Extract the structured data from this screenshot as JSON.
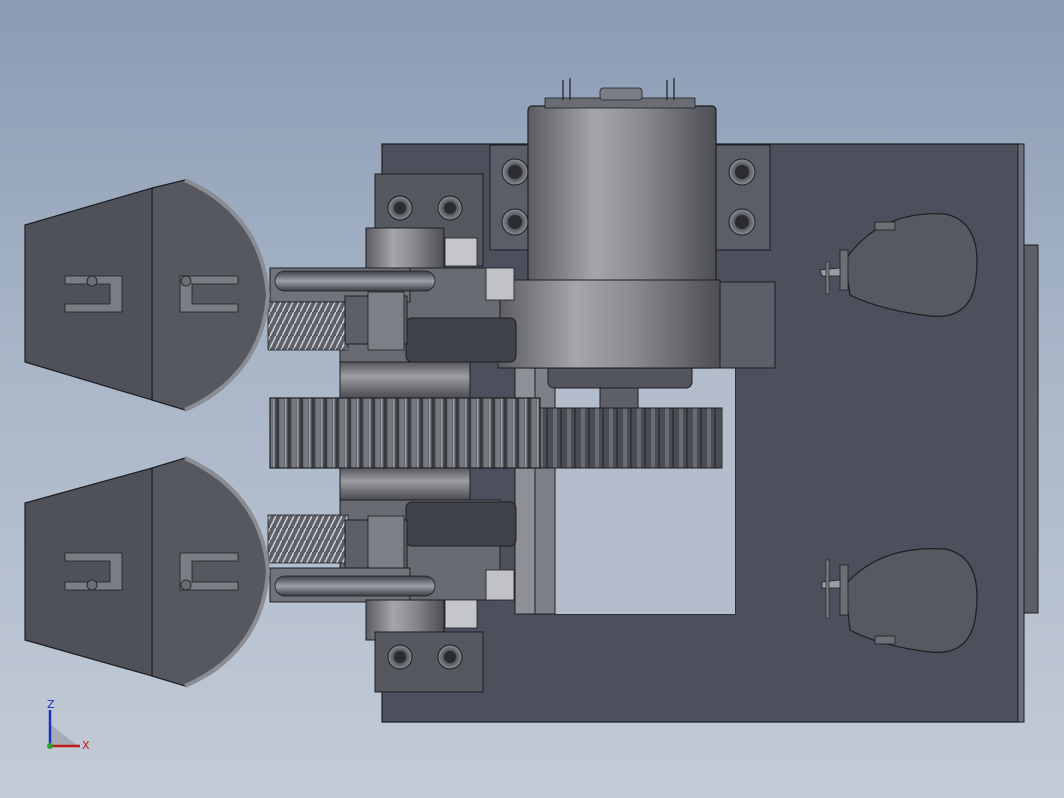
{
  "view": {
    "background_top": "#8a9bb3",
    "background_bottom": "#c3cbd6",
    "part_fill": "#4a4f5c",
    "part_dark": "#3f4450",
    "part_light": "#8a8d93",
    "edge_color": "#1e1e22"
  },
  "triad": {
    "z_label": "Z",
    "x_label": "X",
    "z_color": "#1a2fbf",
    "x_color": "#c41818",
    "y_color": "#2aa02a"
  }
}
